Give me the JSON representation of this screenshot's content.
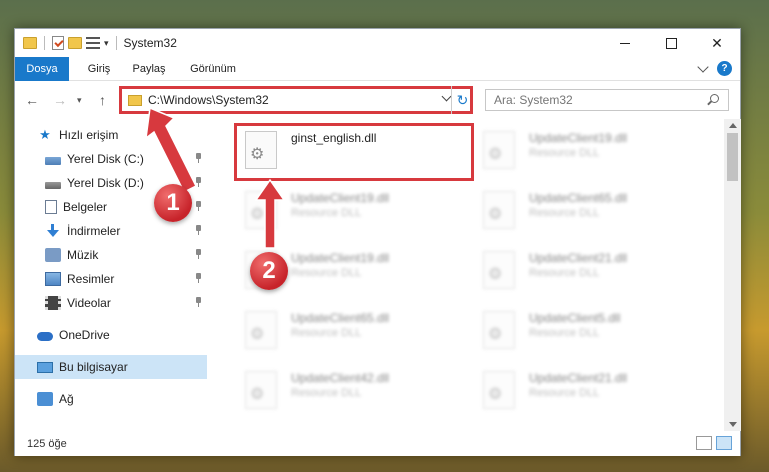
{
  "window": {
    "title": "System32"
  },
  "ribbon": {
    "tabs": [
      "Dosya",
      "Giriş",
      "Paylaş",
      "Görünüm"
    ]
  },
  "address": {
    "path": "C:\\Windows\\System32"
  },
  "search": {
    "placeholder": "Ara: System32"
  },
  "sidebar": {
    "items": [
      {
        "label": "Hızlı erişim",
        "icon": "star-icon",
        "pinned": false
      },
      {
        "label": "Yerel Disk (C:)",
        "icon": "drive-icon",
        "pinned": true
      },
      {
        "label": "Yerel Disk (D:)",
        "icon": "drive-icon",
        "pinned": true
      },
      {
        "label": "Belgeler",
        "icon": "documents-icon",
        "pinned": true
      },
      {
        "label": "İndirmeler",
        "icon": "downloads-icon",
        "pinned": true
      },
      {
        "label": "Müzik",
        "icon": "music-icon",
        "pinned": true
      },
      {
        "label": "Resimler",
        "icon": "pictures-icon",
        "pinned": true
      },
      {
        "label": "Videolar",
        "icon": "videos-icon",
        "pinned": true
      },
      {
        "label": "OneDrive",
        "icon": "cloud-icon",
        "pinned": false
      },
      {
        "label": "Bu bilgisayar",
        "icon": "computer-icon",
        "pinned": false,
        "selected": true
      },
      {
        "label": "Ağ",
        "icon": "network-icon",
        "pinned": false
      }
    ]
  },
  "files": {
    "highlighted": {
      "name": "ginst_english.dll"
    },
    "left": [
      {
        "name": "UpdateClient19.dll",
        "type": "Resource DLL"
      },
      {
        "name": "UpdateClient19.dll",
        "type": "Resource DLL"
      },
      {
        "name": "UpdateClient65.dll",
        "type": "Resource DLL"
      },
      {
        "name": "UpdateClient42.dll",
        "type": "Resource DLL"
      }
    ],
    "right": [
      {
        "name": "UpdateClient19.dll",
        "type": "Resource DLL"
      },
      {
        "name": "UpdateClient65.dll",
        "type": "Resource DLL"
      },
      {
        "name": "UpdateClient21.dll",
        "type": "Resource DLL"
      },
      {
        "name": "UpdateClient5.dll",
        "type": "Resource DLL"
      },
      {
        "name": "UpdateClient21.dll",
        "type": "Resource DLL"
      }
    ]
  },
  "status": {
    "count": "125 öğe"
  },
  "annotations": {
    "step1": "1",
    "step2": "2"
  },
  "colors": {
    "accent": "#1979ca",
    "annotation": "#d7393e",
    "selected": "#cce4f7"
  }
}
